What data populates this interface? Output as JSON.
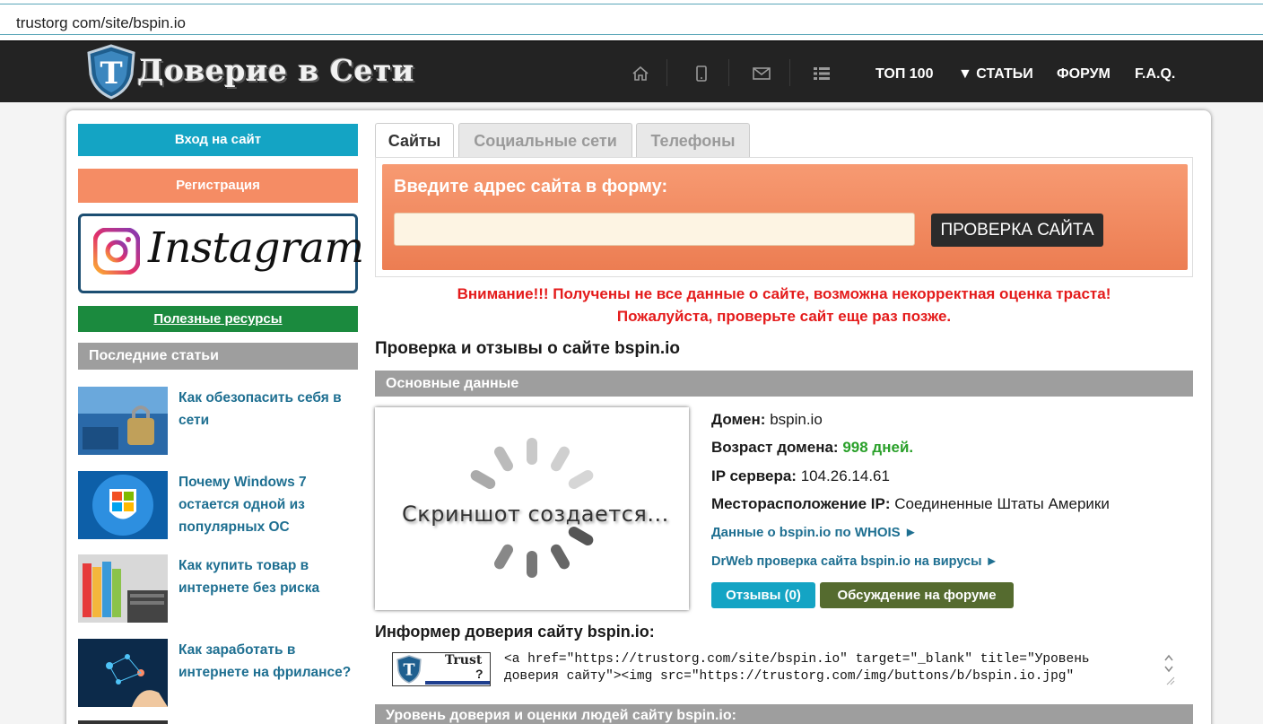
{
  "browser": {
    "url": "trustorg com/site/bspin.io"
  },
  "header": {
    "logo_text": "Доверие в Сети",
    "nav": [
      "ТОП 100",
      "▼ СТАТЬИ",
      "ФОРУМ",
      "F.A.Q."
    ]
  },
  "sidebar": {
    "login": "Вход на сайт",
    "register": "Регистрация",
    "instagram": "Instagram",
    "resources": "Полезные ресурсы",
    "recent_head": "Последние статьи",
    "articles": [
      "Как обезопасить себя в сети",
      "Почему Windows 7 остается одной из популярных ОС",
      "Как купить товар в интернете без риска",
      "Как заработать в интернете на фрилансе?"
    ]
  },
  "tabs": [
    "Сайты",
    "Социальные сети",
    "Телефоны"
  ],
  "form": {
    "label": "Введите адрес сайта в форму:",
    "placeholder": "",
    "button": "ПРОВЕРКА САЙТА"
  },
  "warning": {
    "line1": "Внимание!!! Получены не все данные о сайте, возможна некорректная оценка траста!",
    "line2": "Пожалуйста, проверьте сайт еще раз позже."
  },
  "page_title": "Проверка и отзывы о сайте bspin.io",
  "basic_head": "Основные данные",
  "screenshot_text": "Скриншот создается...",
  "info": {
    "domain_label": "Домен:",
    "domain_value": "bspin.io",
    "age_label": "Возраст домена:",
    "age_value": "998 дней.",
    "ip_label": "IP сервера:",
    "ip_value": "104.26.14.61",
    "loc_label": "Месторасположение IP:",
    "loc_value": "Соединенные Штаты Америки",
    "whois_link": "Данные о bspin.io по WHOIS ►",
    "drweb_link": "DrWeb проверка сайта bspin.io на вирусы ►",
    "reviews_btn": "Отзывы (0)",
    "forum_btn": "Обсуждение на форуме"
  },
  "informer": {
    "title": "Информер доверия сайту bspin.io:",
    "badge_text": "Trust",
    "badge_q": "?",
    "code_line1": "<a href=\"https://trustorg.com/site/bspin.io\" target=\"_blank\" title=\"Уровень",
    "code_line2": "доверия сайту\"><img src=\"https://trustorg.com/img/buttons/b/bspin.io.jpg\""
  },
  "trust_head": "Уровень доверия и оценки людей сайту bspin.io:",
  "colors": {
    "header_bg": "#232323",
    "login": "#14a4c4",
    "register": "#f58c64",
    "resources": "#1b8a3e",
    "form_orange": "#ec7d52",
    "warning": "#e41b1b",
    "link": "#1e6f91",
    "forum_btn": "#556b2f"
  }
}
